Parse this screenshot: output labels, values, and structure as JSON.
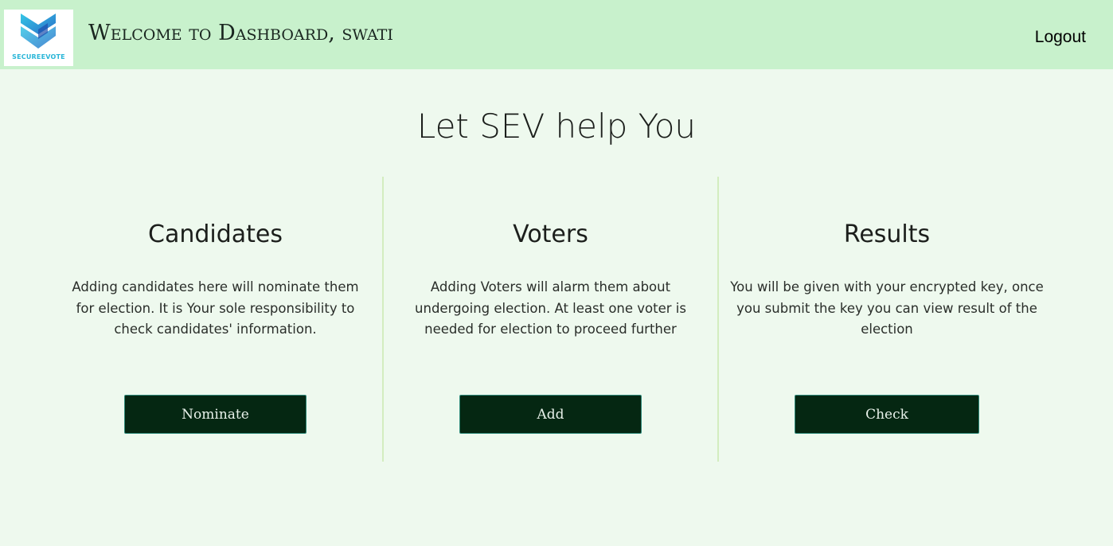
{
  "header": {
    "logo_text": "SECUREEVOTE",
    "welcome_text": "Welcome to Dashboard, swati",
    "logout_label": "Logout"
  },
  "main": {
    "headline": "Let SEV help You"
  },
  "cards": [
    {
      "title": "Candidates",
      "description": "Adding candidates here will nominate them for election. It is Your sole responsibility to check candidates' information.",
      "button_label": "Nominate"
    },
    {
      "title": "Voters",
      "description": "Adding Voters will alarm them about undergoing election. At least one voter is needed for election to proceed further",
      "button_label": "Add"
    },
    {
      "title": "Results",
      "description": "You will be given with your encrypted key, once you submit the key you can view result of the election",
      "button_label": "Check"
    }
  ],
  "colors": {
    "topbar_bg": "#c8f1cc",
    "page_bg": "#eef9ee",
    "button_bg": "#052712",
    "logo_accent": "#2ab6d8"
  }
}
